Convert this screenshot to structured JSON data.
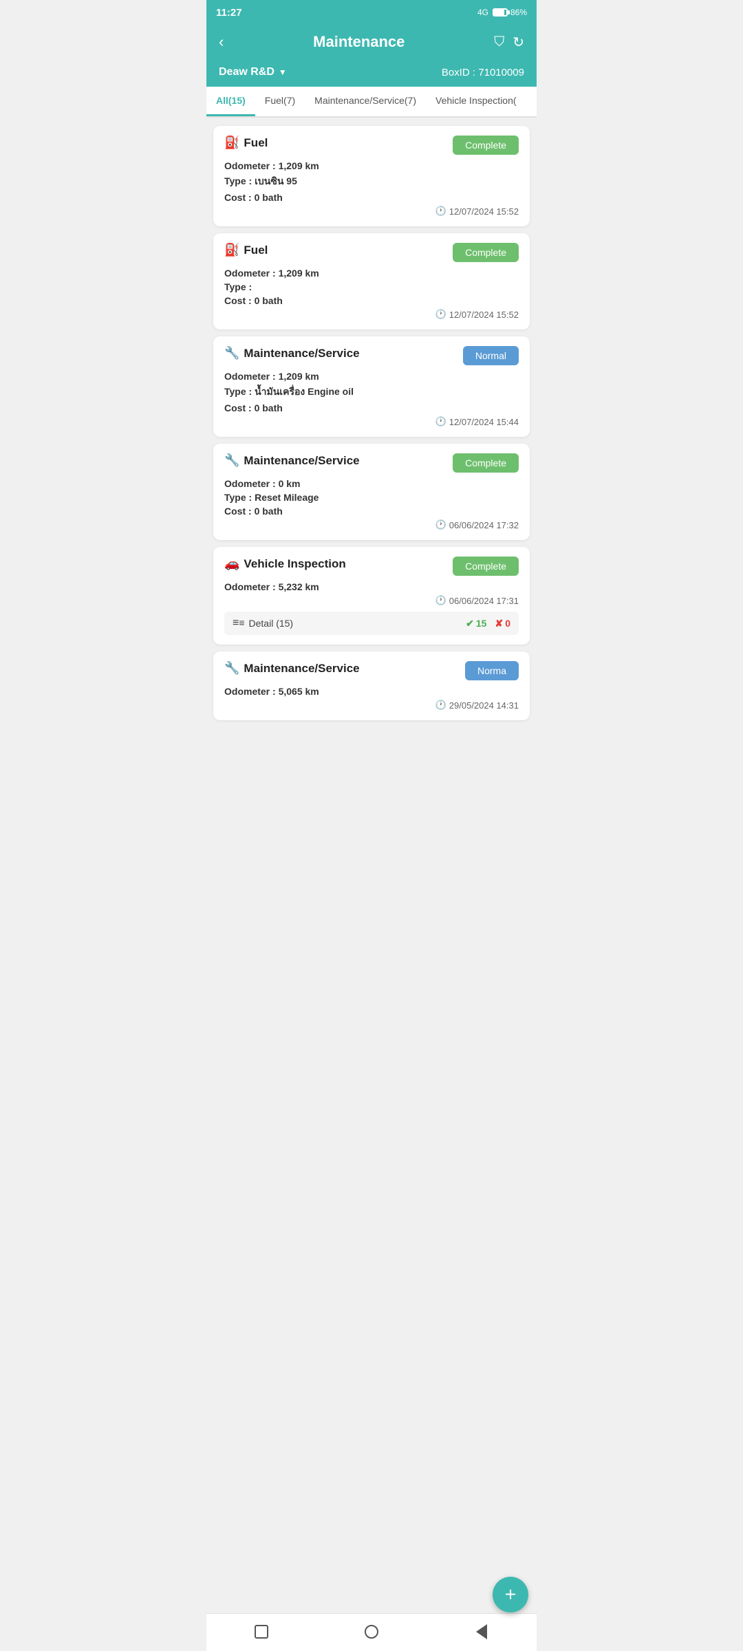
{
  "statusBar": {
    "time": "11:27",
    "battery": "86%",
    "signal": "4G"
  },
  "header": {
    "title": "Maintenance",
    "backLabel": "‹",
    "filterIcon": "filter-icon",
    "refreshIcon": "refresh-icon"
  },
  "subHeader": {
    "companyName": "Deaw  R&D",
    "dropdownLabel": "▼",
    "boxLabel": "BoxID : 71010009"
  },
  "tabs": [
    {
      "label": "All(15)",
      "active": true
    },
    {
      "label": "Fuel(7)",
      "active": false
    },
    {
      "label": "Maintenance/Service(7)",
      "active": false
    },
    {
      "label": "Vehicle Inspection(",
      "active": false
    }
  ],
  "cards": [
    {
      "id": 1,
      "type": "fuel",
      "title": "Fuel",
      "badge": "Complete",
      "badgeType": "complete",
      "odometer": "1,209 km",
      "fuelType": "เบนซิน 95",
      "cost": "0 bath",
      "datetime": "12/07/2024  15:52"
    },
    {
      "id": 2,
      "type": "fuel",
      "title": "Fuel",
      "badge": "Complete",
      "badgeType": "complete",
      "odometer": "1,209 km",
      "fuelType": "",
      "cost": "0 bath",
      "datetime": "12/07/2024  15:52"
    },
    {
      "id": 3,
      "type": "maintenance",
      "title": "Maintenance/Service",
      "badge": "Normal",
      "badgeType": "normal",
      "odometer": "1,209 km",
      "serviceType": "น้ำมันเครื่อง Engine oil",
      "cost": "0 bath",
      "datetime": "12/07/2024  15:44"
    },
    {
      "id": 4,
      "type": "maintenance",
      "title": "Maintenance/Service",
      "badge": "Complete",
      "badgeType": "complete",
      "odometer": "0 km",
      "serviceType": "Reset Mileage",
      "cost": "0 bath",
      "datetime": "06/06/2024  17:32"
    },
    {
      "id": 5,
      "type": "vehicle",
      "title": "Vehicle Inspection",
      "badge": "Complete",
      "badgeType": "complete",
      "odometer": "5,232 km",
      "datetime": "06/06/2024  17:31",
      "detailLabel": "Detail (15)",
      "countOk": 15,
      "countFail": 0
    },
    {
      "id": 6,
      "type": "maintenance",
      "title": "Maintenance/Service",
      "badge": "Norma",
      "badgeType": "normal",
      "odometer": "5,065 km",
      "serviceType": "",
      "cost": "",
      "datetime": "29/05/2024  14:31"
    }
  ],
  "fab": {
    "label": "+"
  },
  "labels": {
    "odometer": "Odometer",
    "type": "Type",
    "cost": "Cost",
    "colon": " : "
  }
}
